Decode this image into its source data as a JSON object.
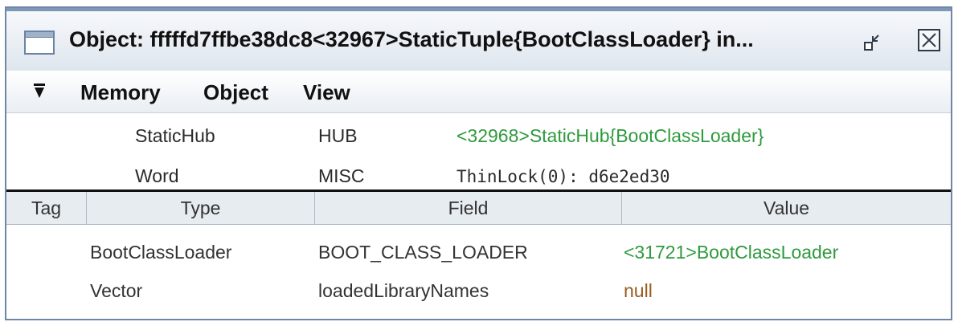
{
  "window": {
    "title": "Object: fffffd7ffbe38dc8<32967>StaticTuple{BootClassLoader} in...",
    "window_icon": "window-icon",
    "restore_icon": "restore-icon",
    "close_icon": "close-icon"
  },
  "menubar": {
    "toggle_icon": "triangle-down-icon",
    "items": [
      "Memory",
      "Object",
      "View"
    ]
  },
  "header_rows": [
    {
      "name": "StaticHub",
      "kind": "HUB",
      "value": "<32968>StaticHub{BootClassLoader}",
      "value_color": "#2e9a3d"
    },
    {
      "name": "Word",
      "kind": "MISC",
      "value": "ThinLock(0): d6e2ed30",
      "value_color": "#2a2a2a"
    }
  ],
  "table": {
    "columns": [
      "Tag",
      "Type",
      "Field",
      "Value"
    ],
    "rows": [
      {
        "tag": "",
        "type": "BootClassLoader",
        "field": "BOOT_CLASS_LOADER",
        "value": "<31721>BootClassLoader",
        "value_color": "#2e9a3d"
      },
      {
        "tag": "",
        "type": "Vector",
        "field": "loadedLibraryNames",
        "value": "null",
        "value_color": "#9a5a1e"
      }
    ]
  },
  "colors": {
    "reference": "#2e9a3d",
    "null": "#9a5a1e",
    "frame_border": "#6f86a6"
  }
}
